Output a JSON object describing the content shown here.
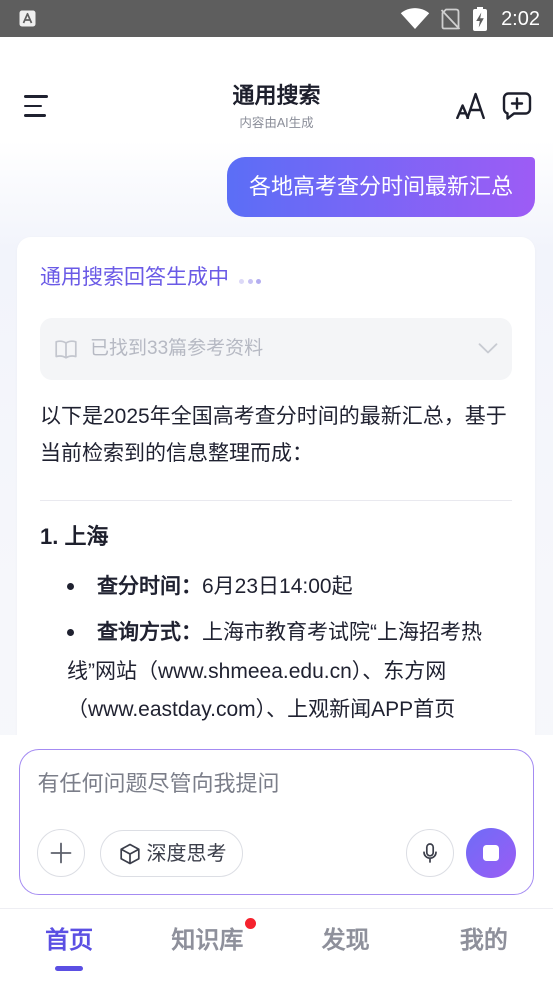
{
  "status_bar": {
    "time": "2:02",
    "icons": [
      "app-notification-icon",
      "wifi-icon",
      "no-sim-icon",
      "battery-charging-icon"
    ]
  },
  "header": {
    "title": "通用搜索",
    "subtitle": "内容由AI生成",
    "menu_icon": "menu-icon",
    "actions": [
      "font-size-icon",
      "new-chat-icon"
    ]
  },
  "chat": {
    "user_message": "各地高考查分时间最新汇总",
    "answer": {
      "status": "通用搜索回答生成中",
      "generating": true,
      "references": {
        "icon": "book-icon",
        "label": "已找到33篇参考资料",
        "expanded": false,
        "toggle_icon": "chevron-down-icon"
      },
      "intro": "以下是2025年全国高考查分时间的最新汇总，基于当前检索到的信息整理而成：",
      "sections": [
        {
          "heading": "1. 上海",
          "items": [
            {
              "label": "查分时间：",
              "text": "6月23日14:00起"
            },
            {
              "label": "查询方式：",
              "text": "上海市教育考试院“上海招考热线”网站（www.shmeea.edu.cn）、东方网（www.eastday.com）、上观新闻APP首页"
            }
          ]
        }
      ]
    }
  },
  "composer": {
    "placeholder": "有任何问题尽管向我提问",
    "attach_icon": "plus-icon",
    "deep_think": {
      "icon": "cube-icon",
      "label": "深度思考",
      "enabled": false
    },
    "voice_icon": "microphone-icon",
    "stop_icon": "stop-icon"
  },
  "bottom_nav": {
    "tabs": [
      {
        "label": "首页",
        "active": true,
        "badge_dot": false
      },
      {
        "label": "知识库",
        "active": false,
        "badge_dot": true
      },
      {
        "label": "发现",
        "active": false,
        "badge_dot": false
      },
      {
        "label": "我的",
        "active": false,
        "badge_dot": false
      }
    ]
  },
  "colors": {
    "accent": "#5b4fe3",
    "bubble_start": "#5b6ef6",
    "bubble_end": "#9d5cf5",
    "badge": "#f5222d"
  }
}
